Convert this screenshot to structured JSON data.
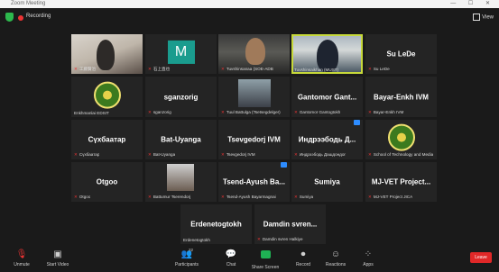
{
  "window": {
    "title": "Zoom Meeting",
    "controls": "— ☐ ✕"
  },
  "topbar": {
    "recording_label": "Recording",
    "view_label": "View"
  },
  "tiles": [
    {
      "name": "",
      "caption": "工藤賢治"
    },
    {
      "name": "",
      "caption": "石上直也",
      "avatar": "M"
    },
    {
      "name": "",
      "caption": "Tuvshinsanaa (SOE-ADB"
    },
    {
      "name": "",
      "caption": "Tuvshinsaikhan (MUST)"
    },
    {
      "name": "Su LeDe",
      "caption": "Su LeDe"
    },
    {
      "name": "",
      "caption": "Enkhmanlai EDSIT"
    },
    {
      "name": "sganzorig",
      "caption": "sganzorig"
    },
    {
      "name": "",
      "caption": "Tuul Battulga (Tsetsegdelger)"
    },
    {
      "name": "Gantomor Gant...",
      "caption": "Gantomor Gantogtokh"
    },
    {
      "name": "Bayar-Enkh IVM",
      "caption": "Bayar-Enkh IVM"
    },
    {
      "name": "Сүхбаатар",
      "caption": "Сүхбаатар"
    },
    {
      "name": "Bat-Uyanga",
      "caption": "Bat-Uyanga"
    },
    {
      "name": "Tsevgedorj IVM",
      "caption": "Tsevgedorj IVM"
    },
    {
      "name": "Индрээбодь Д...",
      "caption": "Индрээбодь Дашдондог"
    },
    {
      "name": "",
      "caption": "School of Technology and Media"
    },
    {
      "name": "Otgoo",
      "caption": "Otgoo"
    },
    {
      "name": "",
      "caption": "Battumur Tserendorj"
    },
    {
      "name": "Tsend-Ayush Ba...",
      "caption": "Tsend-Ayush Bayarmagnai"
    },
    {
      "name": "Sumiya",
      "caption": "Sumiya"
    },
    {
      "name": "MJ-VET Project...",
      "caption": "MJ-VET Project JICA"
    },
    {
      "name": "Erdenetogtokh",
      "caption": "Erdenetogtokh"
    },
    {
      "name": "Damdin svren...",
      "caption": "Damdin svren Halkiye"
    }
  ],
  "toolbar": {
    "unmute": "Unmute",
    "start_video": "Start Video",
    "participants": "Participants",
    "participants_count": "22",
    "chat": "Chat",
    "share_screen": "Share Screen",
    "record": "Record",
    "reactions": "Reactions",
    "apps": "Apps",
    "leave": "Leave"
  },
  "colors": {
    "active_border": "#c6d83a",
    "leave": "#e02828",
    "share": "#1fb254",
    "avatar_m": "#1a9c8e"
  }
}
